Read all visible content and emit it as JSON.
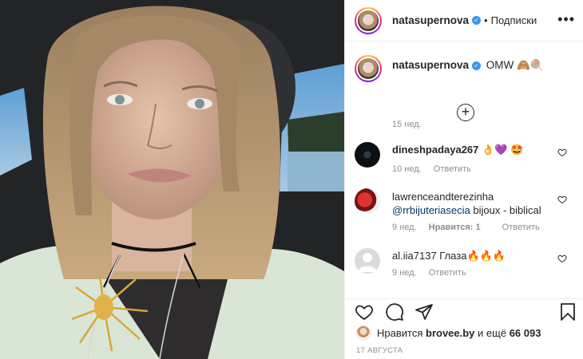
{
  "post": {
    "username": "natasupernova",
    "dot": "•",
    "follow_label": "Подписки",
    "more_label": "•••",
    "caption_text": "OMW 🙈🍭",
    "caption_time": "15 нед.",
    "load_more_label": "+"
  },
  "comments": [
    {
      "username": "dineshpadaya267",
      "text": "👌💜 🤩",
      "mention": "",
      "time": "10 нед.",
      "likes": "",
      "reply": "Ответить"
    },
    {
      "username": "lawrenceandterezinha",
      "text": "bijoux - biblical",
      "mention": "@rrbijuteriasecia",
      "time": "9 нед.",
      "likes": "Нравится: 1",
      "reply": "Ответить"
    },
    {
      "username": "al.iia7137",
      "text": "Глаза🔥🔥🔥",
      "mention": "",
      "time": "9 нед.",
      "likes": "",
      "reply": "Ответить"
    }
  ],
  "likes": {
    "prefix": "Нравится",
    "user": "brovee.by",
    "connector": "и ещё",
    "count": "66 093"
  },
  "date": "17 АВГУСТА",
  "icons": {
    "like": "heart-icon",
    "comment": "comment-icon",
    "share": "share-icon",
    "save": "bookmark-icon",
    "verified": "verified-badge-icon"
  },
  "colors": {
    "verified": "#3897f0",
    "muted": "#8e8e8e",
    "mention": "#00376b"
  }
}
